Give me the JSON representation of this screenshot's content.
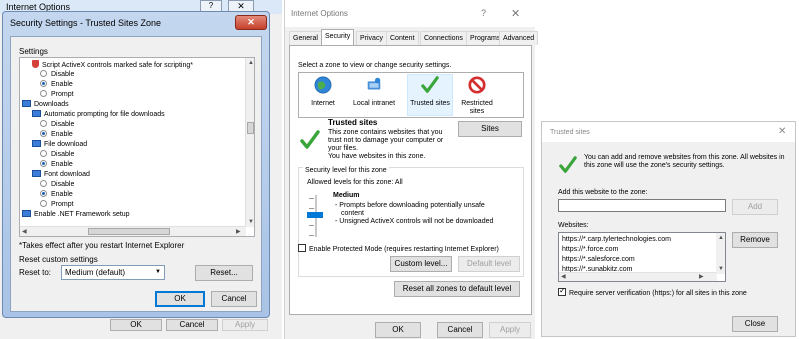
{
  "panel1": {
    "back_window_title": "Internet Options",
    "back_help": "?",
    "back_close": "✕",
    "dialog_title": "Security Settings - Trusted Sites Zone",
    "dialog_close": "✕",
    "settings_label": "Settings",
    "tree": [
      {
        "kind": "item",
        "text": "Script ActiveX controls marked safe for scripting*"
      },
      {
        "kind": "radio",
        "text": "Disable",
        "on": false
      },
      {
        "kind": "radio",
        "text": "Enable",
        "on": true
      },
      {
        "kind": "radio",
        "text": "Prompt",
        "on": false
      },
      {
        "kind": "group",
        "text": "Downloads"
      },
      {
        "kind": "item",
        "text": "Automatic prompting for file downloads"
      },
      {
        "kind": "radio",
        "text": "Disable",
        "on": false
      },
      {
        "kind": "radio",
        "text": "Enable",
        "on": true
      },
      {
        "kind": "item",
        "text": "File download"
      },
      {
        "kind": "radio",
        "text": "Disable",
        "on": false
      },
      {
        "kind": "radio",
        "text": "Enable",
        "on": true
      },
      {
        "kind": "item",
        "text": "Font download"
      },
      {
        "kind": "radio",
        "text": "Disable",
        "on": false
      },
      {
        "kind": "radio",
        "text": "Enable",
        "on": true
      },
      {
        "kind": "radio",
        "text": "Prompt",
        "on": false
      },
      {
        "kind": "group",
        "text": "Enable .NET Framework setup"
      }
    ],
    "note": "*Takes effect after you restart Internet Explorer",
    "reset_custom_label": "Reset custom settings",
    "reset_to_label": "Reset to:",
    "reset_select_value": "Medium (default)",
    "reset_button": "Reset...",
    "ok": "OK",
    "cancel": "Cancel",
    "back_ok": "OK",
    "back_cancel": "Cancel",
    "back_apply": "Apply"
  },
  "panel2": {
    "title": "Internet Options",
    "help": "?",
    "close": "✕",
    "tabs": [
      "General",
      "Security",
      "Privacy",
      "Content",
      "Connections",
      "Programs",
      "Advanced"
    ],
    "active_tab": "Security",
    "zone_instruction": "Select a zone to view or change security settings.",
    "zones": [
      {
        "label": "Internet",
        "icon": "globe-icon"
      },
      {
        "label": "Local intranet",
        "icon": "intranet-icon"
      },
      {
        "label": "Trusted sites",
        "icon": "check-icon"
      },
      {
        "label": "Restricted sites",
        "icon": "restricted-icon"
      }
    ],
    "selected_zone": "Trusted sites",
    "zone_name": "Trusted sites",
    "zone_desc": [
      "This zone contains websites that you",
      "trust not to damage your computer or",
      "your files.",
      "You have websites in this zone."
    ],
    "sites_button": "Sites",
    "security_level_title": "Security level for this zone",
    "allowed_levels": "Allowed levels for this zone: All",
    "level_name": "Medium",
    "level_bullets": [
      "- Prompts before downloading potentially unsafe",
      "content",
      "- Unsigned ActiveX controls will not be downloaded"
    ],
    "protected_mode": "Enable Protected Mode (requires restarting Internet Explorer)",
    "protected_mode_checked": false,
    "custom_level": "Custom level...",
    "default_level": "Default level",
    "reset_all": "Reset all zones to default level",
    "ok": "OK",
    "cancel": "Cancel",
    "apply": "Apply"
  },
  "panel3": {
    "title": "Trusted sites",
    "close": "✕",
    "info": "You can add and remove websites from this zone. All websites in this zone will use the zone's security settings.",
    "add_label": "Add this website to the zone:",
    "add_value": "",
    "add_button": "Add",
    "websites_label": "Websites:",
    "websites": [
      "https://*.carp.tylertechnologies.com",
      "https://*.force.com",
      "https://*.salesforce.com",
      "https://*.sunabkitz.com"
    ],
    "remove_button": "Remove",
    "verify_label": "Require server verification (https:) for all sites in this zone",
    "verify_checked": true,
    "close_button": "Close"
  },
  "colors": {
    "accent": "#0078d7",
    "check_green": "#3aa53a",
    "restricted_red": "#d42f2f"
  }
}
